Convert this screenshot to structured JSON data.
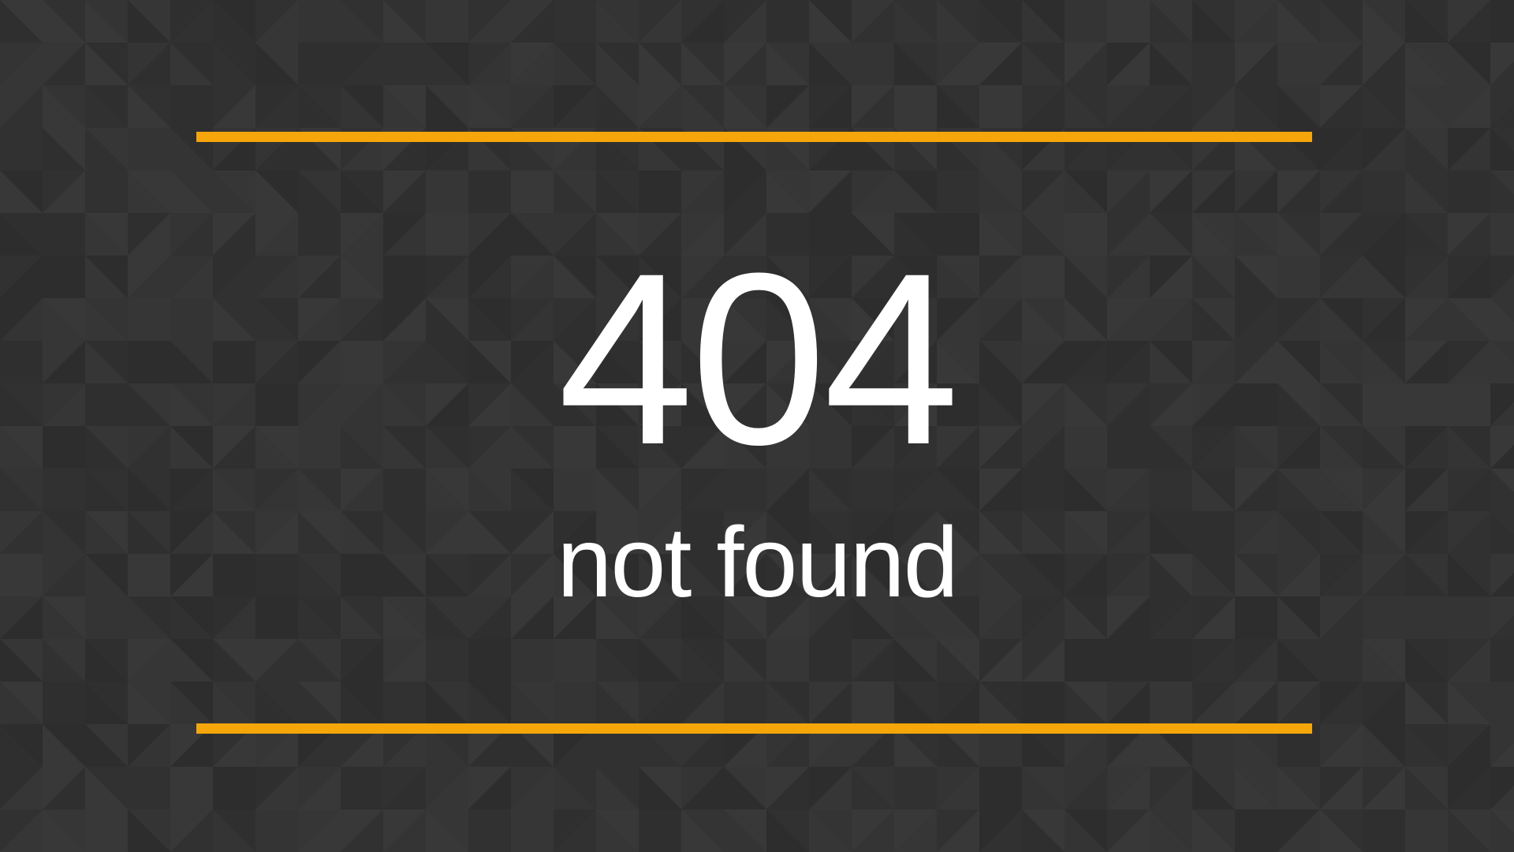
{
  "error": {
    "code": "404",
    "message": "not found"
  },
  "colors": {
    "background": "#333333",
    "accent": "#f5a60a",
    "text": "#ffffff"
  },
  "background_pattern": "geometric-triangles"
}
